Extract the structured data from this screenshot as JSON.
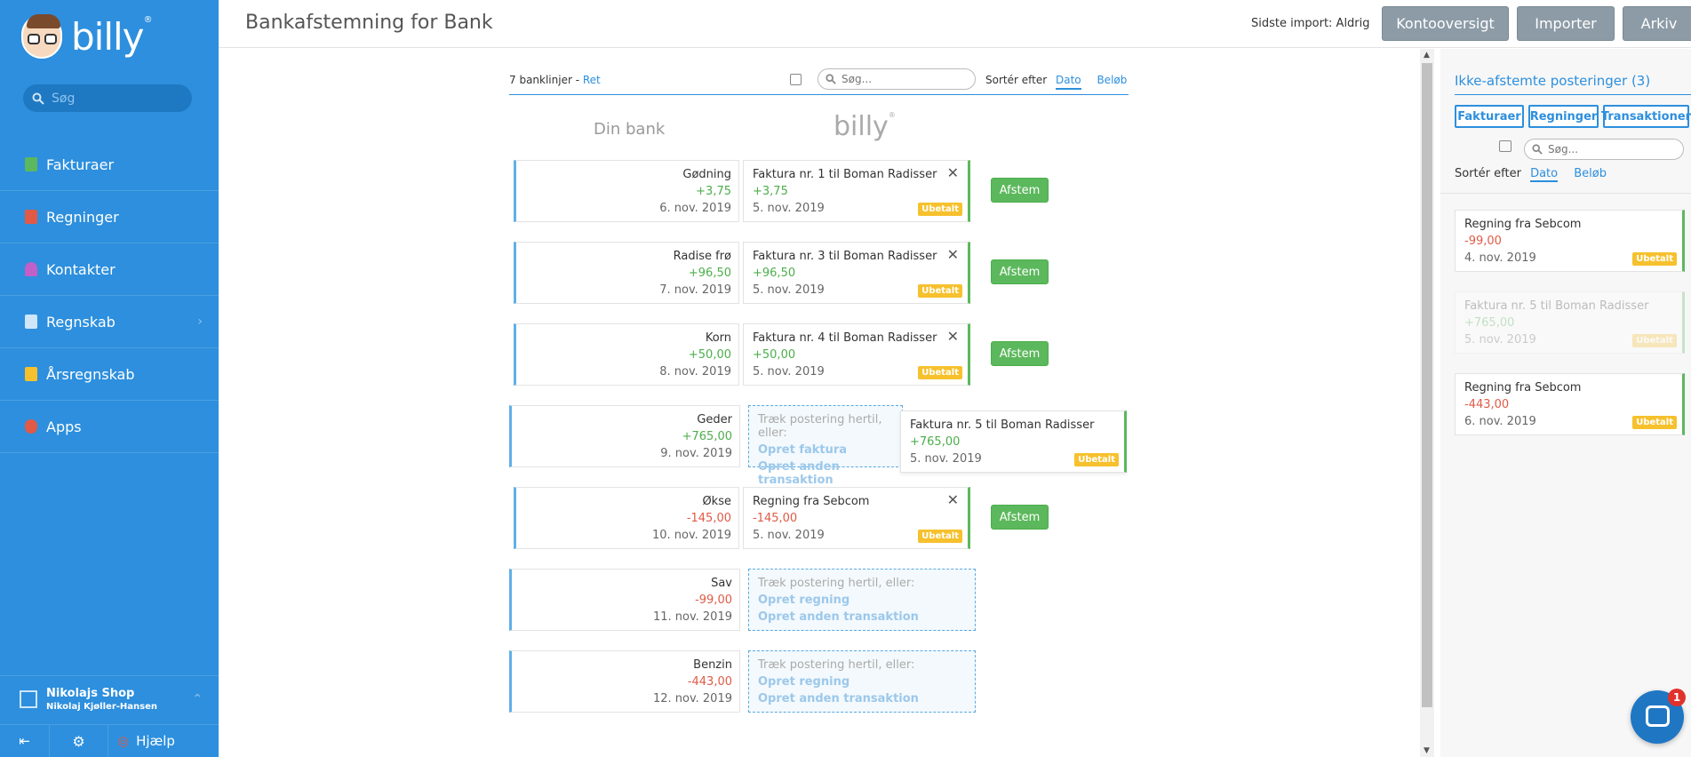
{
  "sidebar": {
    "logo_text": "billy",
    "logo_mark": "®",
    "search_placeholder": "Søg",
    "items": [
      {
        "label": "Fakturaer",
        "icon": "invoice-icon",
        "color": "#5cb85c"
      },
      {
        "label": "Regninger",
        "icon": "bill-icon",
        "color": "#e05a46"
      },
      {
        "label": "Kontakter",
        "icon": "contact-icon",
        "color": "#c060c8"
      },
      {
        "label": "Regnskab",
        "icon": "accounting-icon",
        "color": "#cfe6f9"
      },
      {
        "label": "Årsregnskab",
        "icon": "annual-report-icon",
        "color": "#f6c12d"
      },
      {
        "label": "Apps",
        "icon": "apps-icon",
        "color": "#e05a46"
      }
    ],
    "company_name": "Nikolajs Shop",
    "company_user": "Nikolaj Kjøller-Hansen",
    "help_label": "Hjælp"
  },
  "header": {
    "title": "Bankafstemning for Bank",
    "last_import": "Sidste import: Aldrig",
    "buttons": [
      "Kontooversigt",
      "Importer",
      "Arkiv"
    ]
  },
  "toolbar": {
    "count": "7 banklinjer - ",
    "edit_link": "Ret",
    "search_placeholder": "Søg...",
    "sort_label": "Sortér efter",
    "sort_date": "Dato",
    "sort_amount": "Beløb"
  },
  "columns": {
    "bank": "Din bank",
    "billy": "billy",
    "billy_mark": "®"
  },
  "bank_lines": [
    {
      "name": "Gødning",
      "amount": "+3,75",
      "date": "6. nov. 2019"
    },
    {
      "name": "Radise frø",
      "amount": "+96,50",
      "date": "7. nov. 2019"
    },
    {
      "name": "Korn",
      "amount": "+50,00",
      "date": "8. nov. 2019"
    },
    {
      "name": "Geder",
      "amount": "+765,00",
      "date": "9. nov. 2019"
    },
    {
      "name": "Økse",
      "amount": "-145,00",
      "date": "10. nov. 2019"
    },
    {
      "name": "Sav",
      "amount": "-99,00",
      "date": "11. nov. 2019"
    },
    {
      "name": "Benzin",
      "amount": "-443,00",
      "date": "12. nov. 2019"
    }
  ],
  "matches": [
    {
      "title": "Faktura nr. 1 til Boman Radisser",
      "amount": "+3,75",
      "date": "5. nov. 2019",
      "status": "Ubetalt",
      "close": "✕",
      "action": "Afstem"
    },
    {
      "title": "Faktura nr. 3 til Boman Radisser",
      "amount": "+96,50",
      "date": "5. nov. 2019",
      "status": "Ubetalt",
      "close": "✕",
      "action": "Afstem"
    },
    {
      "title": "Faktura nr. 4 til Boman Radisser",
      "amount": "+50,00",
      "date": "5. nov. 2019",
      "status": "Ubetalt",
      "close": "✕",
      "action": "Afstem"
    },
    {
      "title": "Regning fra Sebcom",
      "amount": "-145,00",
      "date": "5. nov. 2019",
      "status": "Ubetalt",
      "close": "✕",
      "action": "Afstem"
    }
  ],
  "drop_zones": [
    {
      "hint": "Træk postering hertil, eller:",
      "link1": "Opret faktura",
      "link2": "Opret anden transaktion"
    },
    {
      "hint": "Træk postering hertil, eller:",
      "link1": "Opret regning",
      "link2": "Opret anden transaktion"
    },
    {
      "hint": "Træk postering hertil, eller:",
      "link1": "Opret regning",
      "link2": "Opret anden transaktion"
    }
  ],
  "dragging": {
    "title": "Faktura nr. 5 til Boman Radisser",
    "amount": "+765,00",
    "date": "5. nov. 2019",
    "status": "Ubetalt"
  },
  "right_panel": {
    "title": "Ikke-afstemte posteringer (3)",
    "filters": [
      "Fakturaer",
      "Regninger",
      "Transaktioner"
    ],
    "search_placeholder": "Søg...",
    "sort_label": "Sortér efter",
    "sort_date": "Dato",
    "sort_amount": "Beløb",
    "items": [
      {
        "title": "Regning fra Sebcom",
        "amount": "-99,00",
        "date": "4. nov. 2019",
        "status": "Ubetalt"
      },
      {
        "title": "Faktura nr. 5 til Boman Radisser",
        "amount": "+765,00",
        "date": "5. nov. 2019",
        "status": "Ubetalt"
      },
      {
        "title": "Regning fra Sebcom",
        "amount": "-443,00",
        "date": "6. nov. 2019",
        "status": "Ubetalt"
      }
    ]
  },
  "chat": {
    "badge": "1"
  },
  "colors": {
    "brand": "#2d8fdd",
    "positive": "#4cae4c",
    "negative": "#e05a46",
    "unpaid": "#f6c12d",
    "match": "#5cb85c"
  }
}
